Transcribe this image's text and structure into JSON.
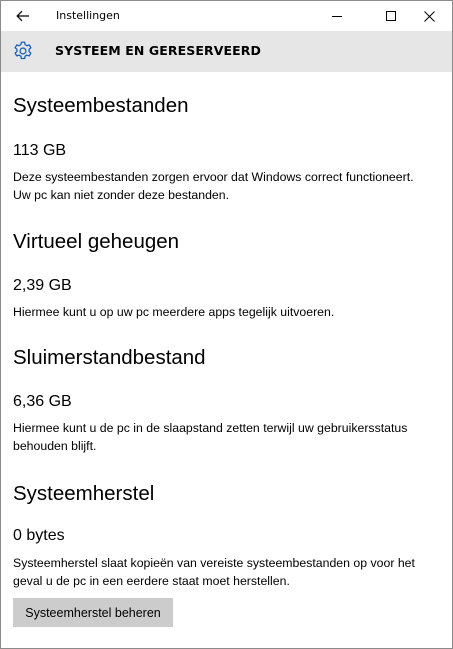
{
  "window": {
    "title": "Instellingen"
  },
  "header": {
    "title": "SYSTEEM EN GERESERVEERD",
    "icon": "gear-icon"
  },
  "sections": [
    {
      "title": "Systeembestanden",
      "size": "113 GB",
      "description": "Deze systeembestanden zorgen ervoor dat Windows correct functioneert. Uw pc kan niet zonder deze bestanden."
    },
    {
      "title": "Virtueel geheugen",
      "size": "2,39 GB",
      "description": "Hiermee kunt u op uw pc meerdere apps tegelijk uitvoeren."
    },
    {
      "title": "Sluimerstandbestand",
      "size": "6,36 GB",
      "description": "Hiermee kunt u de pc in de slaapstand zetten terwijl uw gebruikersstatus behouden blijft."
    },
    {
      "title": "Systeemherstel",
      "size": "0 bytes",
      "description": "Systeemherstel slaat kopieën van vereiste systeembestanden op voor het geval u de pc in een eerdere staat moet herstellen."
    }
  ],
  "actions": {
    "manage_restore_label": "Systeemherstel beheren"
  }
}
